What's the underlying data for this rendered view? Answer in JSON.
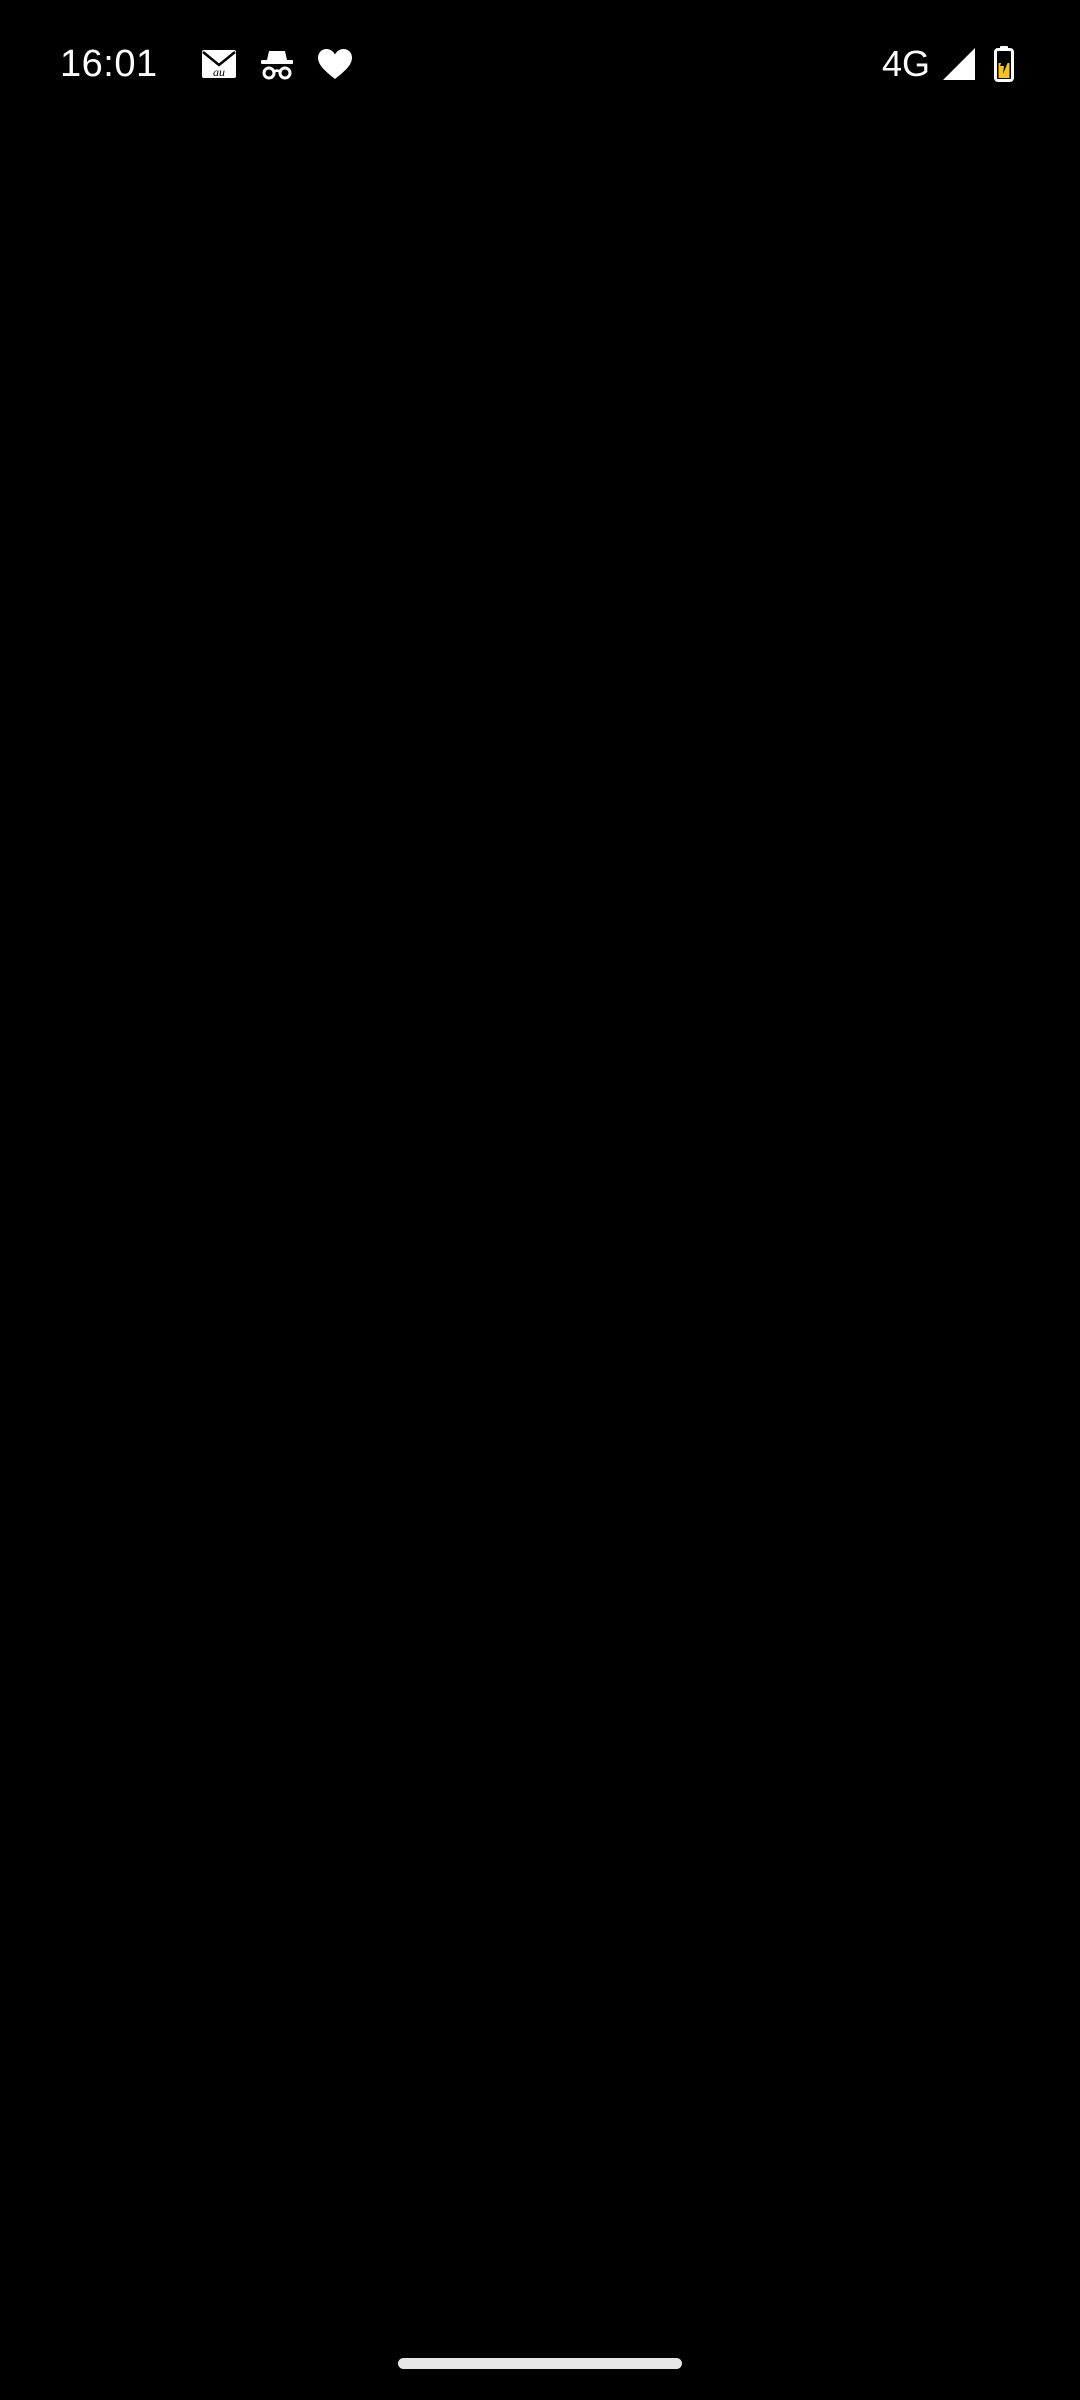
{
  "status_bar": {
    "time": "16:01",
    "notification_icons": [
      "au-mail-icon",
      "incognito-icon",
      "heart-icon"
    ],
    "network_type": "4G",
    "signal_icon": "cellular-signal-icon",
    "battery_icon": "battery-charging-icon"
  },
  "colors": {
    "background": "#000000",
    "foreground": "#ffffff",
    "battery_fill": "#f6c21b"
  },
  "navigation": {
    "gesture_handle": "home-gesture-handle"
  }
}
